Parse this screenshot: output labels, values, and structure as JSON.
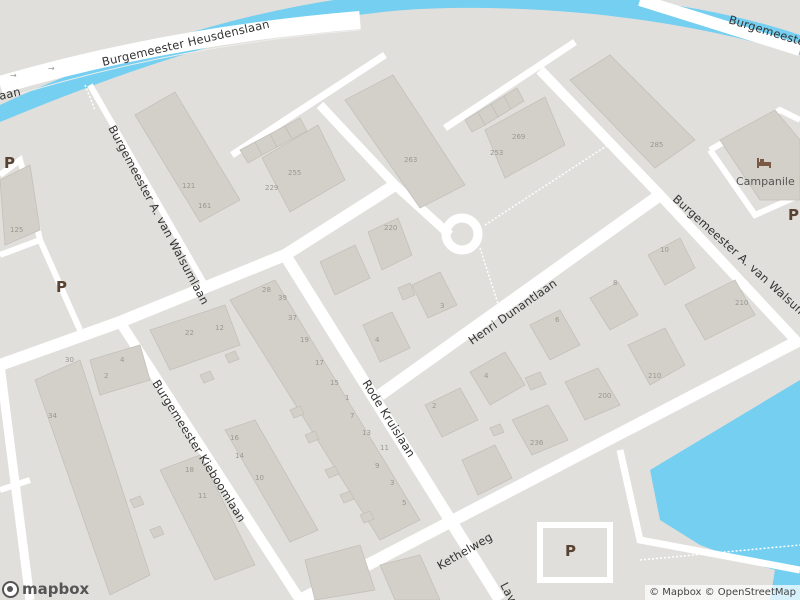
{
  "map": {
    "colors": {
      "land": "#e0dfdc",
      "water": "#75cff0",
      "road": "#ffffff",
      "building": "#d3cfc9",
      "building_outline": "#c4c0b9"
    },
    "streets": {
      "heusdenslaan": "Burgemeester Heusdenslaan",
      "heusdenslaan_right": "Burgemeester",
      "walsumlaan_left": "Burgemeester A. van Walsumlaan",
      "walsumlaan_right": "Burgemeester A. van Walsumlaan",
      "dunantlaan": "Henri Dunantlaan",
      "kieboomlaan": "Burgemeester Kieboomlaan",
      "kruislaan": "Rode Kruislaan",
      "kethelweg": "Kethelweg",
      "lav": "Lav",
      "aan": "aan"
    },
    "poi": {
      "hotel_icon": "bed-icon",
      "hotel_label": "Campanile"
    },
    "parking_symbol": "P",
    "building_numbers": [
      "121",
      "161",
      "229",
      "255",
      "263",
      "253",
      "269",
      "285",
      "220",
      "3",
      "4",
      "10",
      "8",
      "210",
      "210",
      "2",
      "200",
      "236",
      "6",
      "4",
      "28",
      "4",
      "2",
      "12",
      "22",
      "16",
      "18",
      "11",
      "10",
      "14",
      "5",
      "3",
      "9",
      "7",
      "11",
      "13",
      "15",
      "17",
      "19",
      "37",
      "39",
      "1",
      "34",
      "125",
      "30"
    ]
  },
  "logo": {
    "text": "mapbox"
  },
  "attribution": {
    "mapbox": "© Mapbox",
    "osm": "© OpenStreetMap"
  }
}
